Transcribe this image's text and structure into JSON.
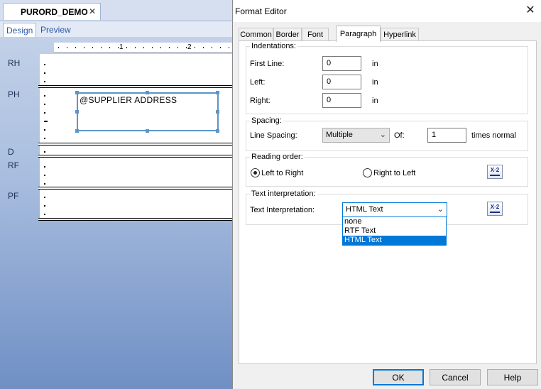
{
  "designer": {
    "doc_tab": "PURORD_DEMO",
    "doc_tab_close": "✕",
    "view_tabs": [
      "Design",
      "Preview"
    ],
    "ruler_marks": [
      "1",
      "2"
    ],
    "bands": [
      "RH",
      "PH",
      "D",
      "RF",
      "PF"
    ],
    "field_text": "@SUPPLIER ADDRESS"
  },
  "dialog": {
    "title": "Format Editor",
    "close_glyph": "✕",
    "tabs": [
      "Common",
      "Border",
      "Font",
      "Paragraph",
      "Hyperlink"
    ],
    "active_tab": "Paragraph",
    "indentations": {
      "title": "Indentations:",
      "first_line_label": "First Line:",
      "first_line_value": "0",
      "left_label": "Left:",
      "left_value": "0",
      "right_label": "Right:",
      "right_value": "0",
      "unit": "in"
    },
    "spacing": {
      "title": "Spacing:",
      "line_spacing_label": "Line Spacing:",
      "line_spacing_value": "Multiple",
      "of_label": "Of:",
      "of_value": "1",
      "times_label": "times normal"
    },
    "reading_order": {
      "title": "Reading order:",
      "ltr_label": "Left to Right",
      "rtl_label": "Right to Left",
      "selected": "Left to Right"
    },
    "text_interpretation": {
      "title": "Text interpretation:",
      "label": "Text Interpretation:",
      "value": "HTML Text",
      "options": [
        "none",
        "RTF Text",
        "HTML Text"
      ]
    },
    "expr_button_text": "X·2",
    "buttons": {
      "ok": "OK",
      "cancel": "Cancel",
      "help": "Help"
    }
  },
  "colors": {
    "accent": "#0078d7",
    "band_blue": "#4a6ea9",
    "field_border": "#5b95c9"
  }
}
